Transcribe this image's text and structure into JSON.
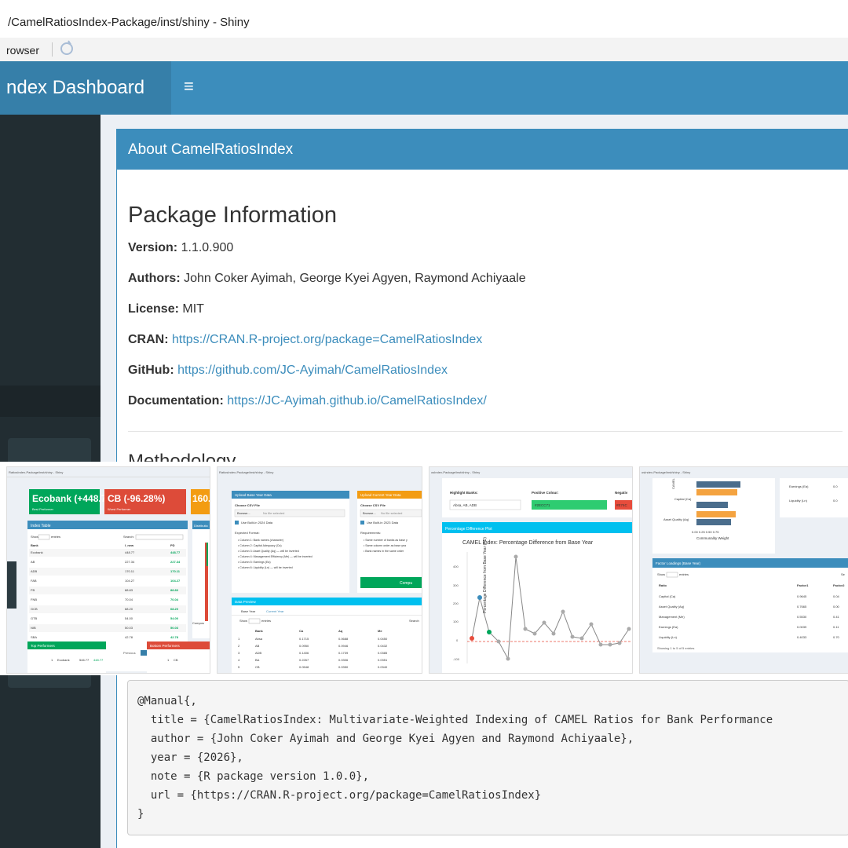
{
  "window": {
    "title": "/CamelRatiosIndex-Package/inst/shiny - Shiny"
  },
  "viewer": {
    "browser_label": "rowser"
  },
  "header": {
    "brand": "ndex Dashboard",
    "menu_icon": "hamburger-icon"
  },
  "about_box": {
    "title": "About CamelRatiosIndex",
    "section_title": "Package Information",
    "version": {
      "label": "Version:",
      "value": "1.1.0.900"
    },
    "authors": {
      "label": "Authors:",
      "value": "John Coker Ayimah, George Kyei Agyen, Raymond Achiyaale"
    },
    "license": {
      "label": "License:",
      "value": "MIT"
    },
    "cran": {
      "label": "CRAN:",
      "value": "https://CRAN.R-project.org/package=CamelRatiosIndex"
    },
    "github": {
      "label": "GitHub:",
      "value": "https://github.com/JC-Ayimah/CamelRatiosIndex"
    },
    "documentation": {
      "label": "Documentation:",
      "value": "https://JC-Ayimah.github.io/CamelRatiosIndex/"
    },
    "next_section": "Methodology"
  },
  "screenshots": {
    "shot1": {
      "url": "RatiosIndex-Package/inst/shiny - Shiny",
      "best_value": "Ecobank (+448.77",
      "best_label": "Best Performer",
      "worst_value": "CB (-96.28%)",
      "worst_label": "Worst Performer",
      "third_value": "160.",
      "index_table": "Index Table",
      "show": "Show",
      "entries": "entries",
      "search": "Search:",
      "col_bank": "Bank",
      "col_tnew": "I_new",
      "col_pd": "PD",
      "rows": [
        {
          "bank": "Ecobank",
          "v": "448.77",
          "pd": "448.77"
        },
        {
          "bank": "AB",
          "v": "227.34",
          "pd": "227.34"
        },
        {
          "bank": "ADB",
          "v": "170.11",
          "pd": "170.11"
        },
        {
          "bank": "FAB",
          "v": "104.27",
          "pd": "104.27"
        },
        {
          "bank": "FB",
          "v": "88.83",
          "pd": "88.83"
        },
        {
          "bank": "FNB",
          "v": "70.04",
          "pd": "70.04"
        },
        {
          "bank": "GCB",
          "v": "68.20",
          "pd": "68.20"
        },
        {
          "bank": "GTB",
          "v": "54.00",
          "pd": "54.00"
        },
        {
          "bank": "NIB",
          "v": "50.03",
          "pd": "50.03"
        },
        {
          "bank": "SBA",
          "v": "42.78",
          "pd": "42.78"
        }
      ],
      "showing": "Showing 1 to 10 of 21 entries",
      "prev": "Previous",
      "next": "Next",
      "top_performers": "Top Performers",
      "bottom_performers": "Bottom Performers",
      "top_row_rank": "1",
      "top_row_bank": "Ecobank",
      "top_row_v": "546.77",
      "top_row_pd": "448.77",
      "bottom_row_rank": "1",
      "bottom_row_bank": "CB",
      "dist_title": "Distributio",
      "count_label": "count",
      "compos_label": "Compos"
    },
    "shot2": {
      "url": "RatiosIndex-Package/inst/shiny - Shiny",
      "base_upload": "Upload Base Year Data",
      "current_upload": "Upload Current Year Data",
      "choose_csv": "Choose CSV File",
      "browse": "Browse...",
      "no_file": "No file selected",
      "builtin_2024": "Use Built-in 2024 Data",
      "builtin_2023": "Use Built-in 2023 Data",
      "expected": "Expected Format:",
      "formats": [
        "Column 1: Bank names (character)",
        "Column 2: Capital Adequacy (Ca)",
        "Column 3: Asset Quality (Aq) — will be inverted",
        "Column 4: Management Efficiency (Me) — will be inverted",
        "Column 5: Earnings (Ea)",
        "Column 6: Liquidity (Ln) — will be inverted"
      ],
      "requirements": "Requirements:",
      "reqs": [
        "Same number of banks as base y",
        "Same column order as base yea",
        "Bank names in the same order"
      ],
      "compute": "Compu",
      "data_preview": "Data Preview",
      "tab_base": "Base Year",
      "tab_current": "Current Year",
      "show": "Show",
      "entries": "entries",
      "search": "Search",
      "cols": [
        "Bank",
        "Ca",
        "Aq",
        "Me"
      ],
      "rows": [
        [
          "1",
          "Absa",
          "0.1715",
          "0.0688",
          "0.0450"
        ],
        [
          "2",
          "AB",
          "0.0950",
          "0.0946",
          "0.0432"
        ],
        [
          "3",
          "ADB",
          "0.1406",
          "0.1739",
          "0.0385"
        ],
        [
          "4",
          "BA",
          "0.2267",
          "0.0306",
          "0.0351"
        ],
        [
          "5",
          "CB",
          "0.0548",
          "0.0350",
          "0.0340"
        ]
      ]
    },
    "shot3": {
      "url": "osIndex-Package/inst/shiny - Shiny",
      "highlight": "Highlight Banks:",
      "highlight_value": "Absa, AB, ADB",
      "pos_colour": "Positive Colour:",
      "pos_value": "#2ECC71",
      "neg_colour": "Negativ",
      "neg_value": "#E74C",
      "plot_title": "Percentage Difference Plot",
      "chart_title": "CAMEL Index: Percentage Difference from Base Year",
      "ylabel": "Percentage Difference from Base Year (PD)"
    },
    "shot4": {
      "url": "osIndex-Package/inst/shiny - Shiny",
      "camel_label": "CAMEL",
      "capital": "Capital (Ca)",
      "asset": "Asset Quality (Aq)",
      "earnings": "Earnings (Ea)",
      "liquidity": "Liquidity (Ln)",
      "earnings_val": "0.0",
      "liquidity_val": "0.0",
      "ticks": "0.00  0.25  0.50  0.75",
      "axis_label": "Communality Weight",
      "factor_title": "Factor Loadings (Base Year)",
      "show": "Show",
      "entries": "entries",
      "search": "Se",
      "col_ratio": "Ratio",
      "col_f1": "Factor1",
      "col_f2": "Factor2",
      "rows": [
        [
          "Capital (Ca)",
          "0.9645",
          "0.04"
        ],
        [
          "Asset Quality (Aq)",
          "0.7665",
          "0.00"
        ],
        [
          "Management (Me)",
          "0.5530",
          "0.41"
        ],
        [
          "Earnings (Ea)",
          "0.0039",
          "0.11"
        ],
        [
          "Liquidity (Ln)",
          "0.4033",
          "0.70"
        ]
      ],
      "showing": "Showing 1 to 5 of 5 entries"
    }
  },
  "citation": {
    "lines": [
      "@Manual{,",
      "  title = {CamelRatiosIndex: Multivariate-Weighted Indexing of CAMEL Ratios for Bank Performance",
      "  author = {John Coker Ayimah and George Kyei Agyen and Raymond Achiyaale},",
      "  year = {2026},",
      "  note = {R package version 1.0.0},",
      "  url = {https://CRAN.R-project.org/package=CamelRatiosIndex}",
      "}"
    ]
  },
  "colors": {
    "primary": "#3c8dbc",
    "header_dark": "#367fa9",
    "sidebar": "#222d32",
    "green": "#00a65a",
    "red": "#dd4b39",
    "orange": "#f39c12",
    "aqua": "#00c0ef",
    "link": "#3c8dbc"
  }
}
